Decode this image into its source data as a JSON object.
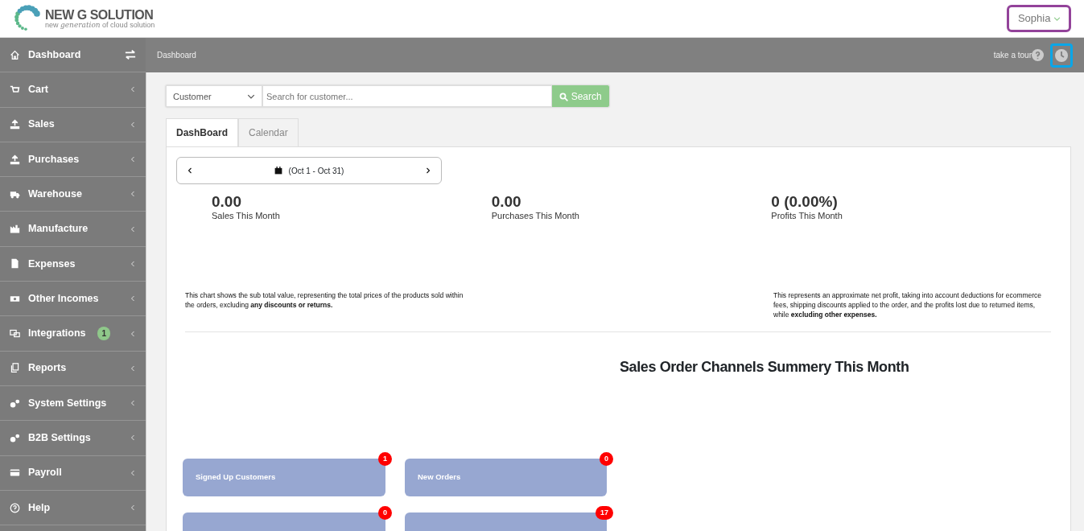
{
  "header": {
    "logo_title": "NEW G SOLUTION",
    "logo_tagline_parts": [
      "new ",
      "generation",
      " of cloud solution"
    ],
    "user": {
      "name": "Sophia",
      "highlighted": true
    }
  },
  "sidebar": {
    "items": [
      {
        "label": "Dashboard",
        "kind": "toggle"
      },
      {
        "label": "Cart",
        "kind": "menu"
      },
      {
        "label": "Sales",
        "kind": "menu"
      },
      {
        "label": "Purchases",
        "kind": "menu"
      },
      {
        "label": "Warehouse",
        "kind": "menu"
      },
      {
        "label": "Manufacture",
        "kind": "menu"
      },
      {
        "label": "Expenses",
        "kind": "menu"
      },
      {
        "label": "Other Incomes",
        "kind": "menu"
      },
      {
        "label": "Integrations",
        "kind": "menu",
        "badge": "1"
      },
      {
        "label": "Reports",
        "kind": "menu"
      },
      {
        "label": "System Settings",
        "kind": "menu"
      },
      {
        "label": "B2B Settings",
        "kind": "menu"
      },
      {
        "label": "Payroll",
        "kind": "menu"
      },
      {
        "label": "Help",
        "kind": "menu"
      }
    ]
  },
  "topbar": {
    "breadcrumb": "Dashboard",
    "tour_link": "take a tour",
    "clock": {
      "highlighted": true
    }
  },
  "search": {
    "scope": "Customer",
    "placeholder": "Search for customer...",
    "button": "Search"
  },
  "tabs": [
    {
      "label": "DashBoard",
      "selected": true
    },
    {
      "label": "Calendar",
      "selected": false
    }
  ],
  "date_range": {
    "label": "(Oct 1 - Oct 31)"
  },
  "stats": [
    {
      "value": "0.00",
      "label": "Sales This Month"
    },
    {
      "value": "0.00",
      "label": "Purchases This Month"
    },
    {
      "value": "0 (0.00%)",
      "label": "Profits This Month"
    }
  ],
  "notes": [
    "This chart shows the sub total value, representing the total prices of the products sold within the orders, excluding **any discounts or returns.**",
    "This represents an approximate net profit, taking into account deductions for ecommerce fees, shipping discounts applied to the order, and the profits lost due to returned items, while **excluding other expenses.**"
  ],
  "channels_title": "Sales Order Channels Summery This Month",
  "tiles": [
    {
      "label": "Signed Up Customers",
      "count": "1"
    },
    {
      "label": "New Orders",
      "count": "0"
    },
    {
      "count": "0"
    },
    {
      "count": "17"
    }
  ]
}
